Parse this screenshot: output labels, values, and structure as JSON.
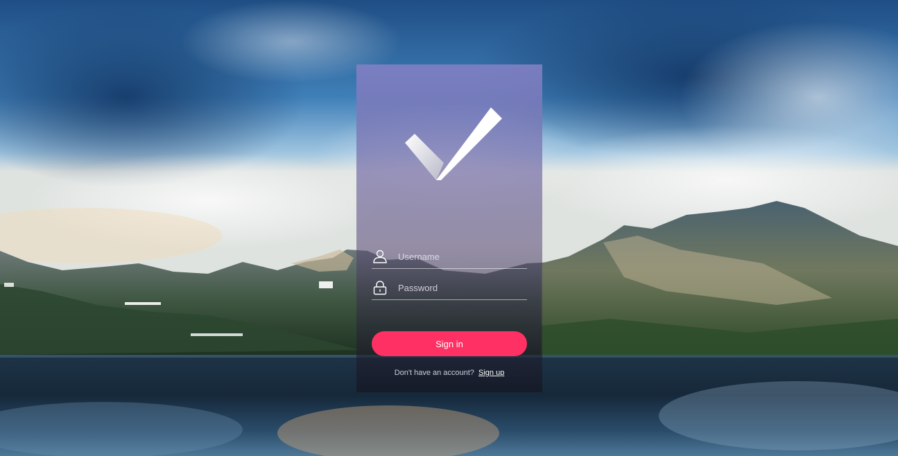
{
  "login": {
    "username_placeholder": "Username",
    "password_placeholder": "Password",
    "signin_label": "Sign in",
    "no_account_text": "Don't have an account?",
    "signup_label": "Sign up"
  },
  "icons": {
    "logo": "checkmark-logo-icon",
    "username": "user-icon",
    "password": "lock-icon"
  },
  "colors": {
    "accent": "#ff3164",
    "card_top": "#8080c4",
    "sky": "#3c7cbc"
  }
}
